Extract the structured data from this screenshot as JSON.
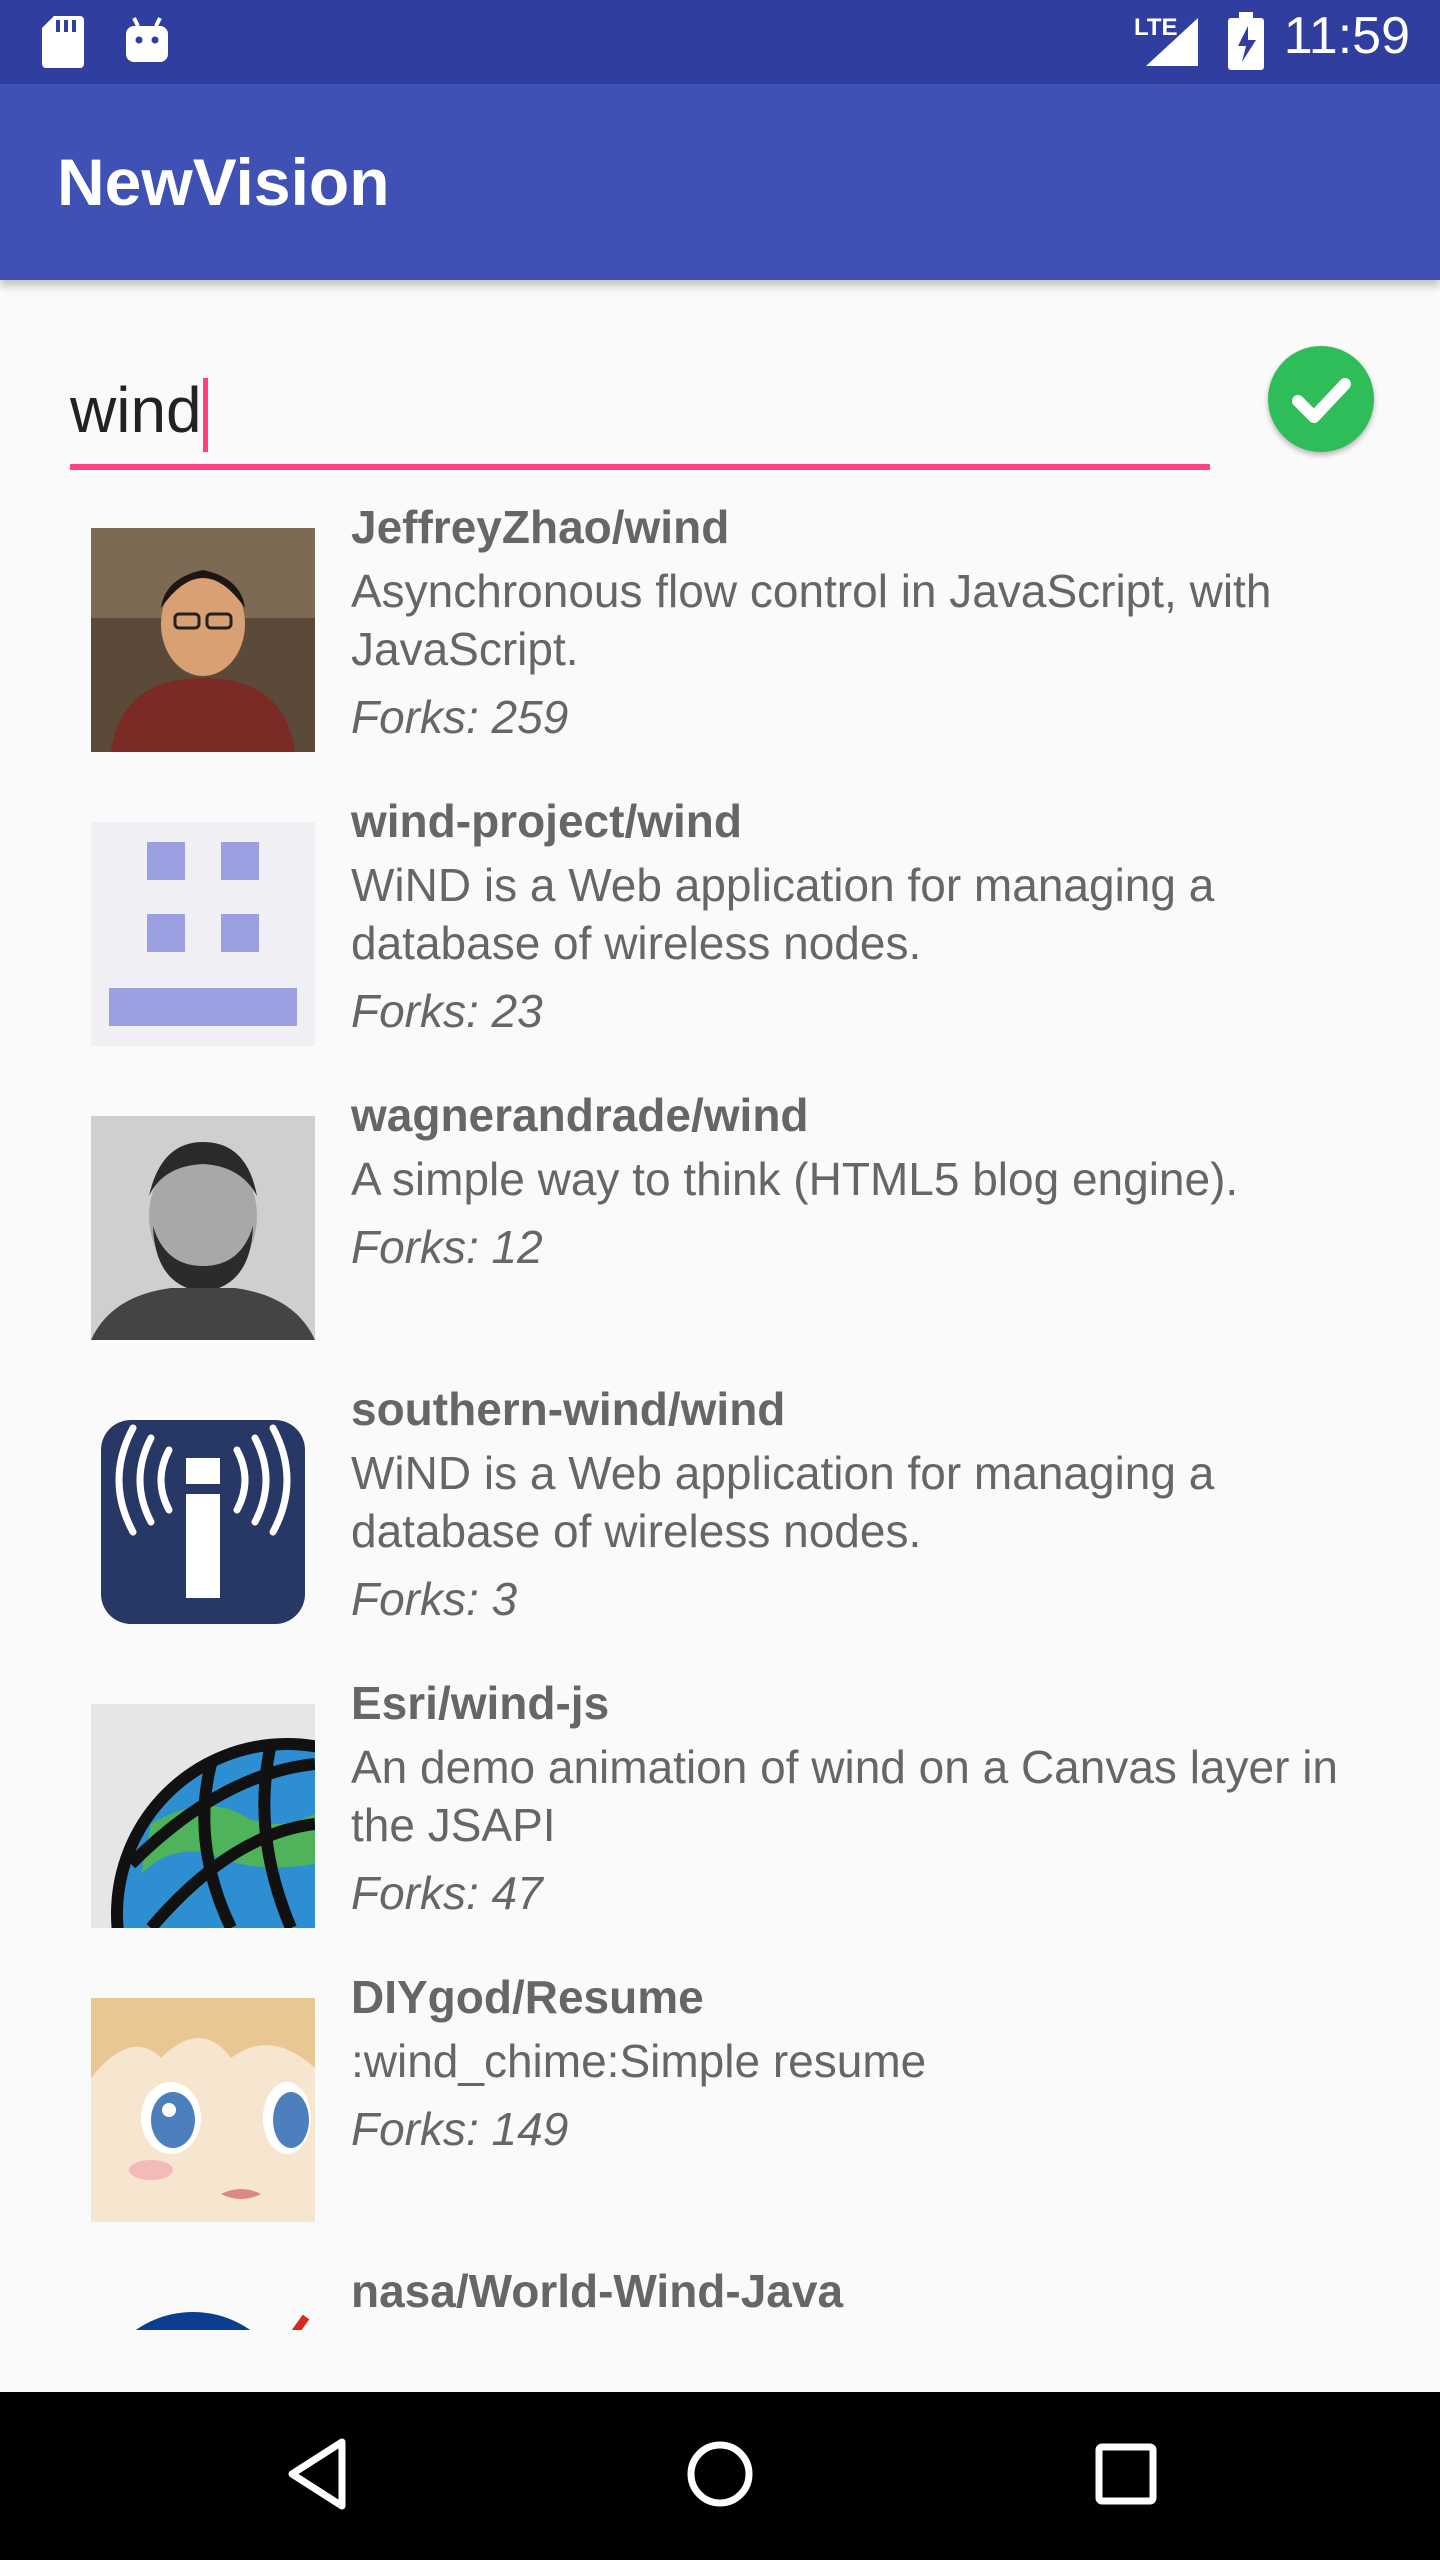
{
  "status_bar": {
    "time": "11:59",
    "network": "LTE",
    "left_icons": [
      "sd-card-icon",
      "android-icon"
    ],
    "right_icons": [
      "signal-icon",
      "battery-charging-icon"
    ]
  },
  "app_bar": {
    "title": "NewVision",
    "color": "#3f51b5"
  },
  "search": {
    "value": "wind",
    "underline_color": "#ff4081",
    "confirm_icon": "check-circle-icon",
    "confirm_color": "#2ebd59"
  },
  "repos": [
    {
      "name": "JeffreyZhao/wind",
      "description": "Asynchronous flow control in JavaScript, with JavaScript.",
      "forks": "Forks: 259",
      "avatar": "person-photo"
    },
    {
      "name": "wind-project/wind",
      "description": "WiND is a Web application for managing a database of wireless nodes.",
      "forks": "Forks: 23",
      "avatar": "identicon"
    },
    {
      "name": "wagnerandrade/wind",
      "description": "A simple way to think (HTML5 blog engine).",
      "forks": "Forks: 12",
      "avatar": "person-photo-bw"
    },
    {
      "name": "southern-wind/wind",
      "description": "WiND is a Web application for managing a database of wireless nodes.",
      "forks": "Forks: 3",
      "avatar": "wireless-info-logo"
    },
    {
      "name": "Esri/wind-js",
      "description": "An demo animation of wind on a Canvas layer in the JSAPI",
      "forks": "Forks: 47",
      "avatar": "globe-logo"
    },
    {
      "name": "DIYgod/Resume",
      "description": ":wind_chime:Simple resume",
      "forks": "Forks: 149",
      "avatar": "anime-avatar"
    },
    {
      "name": "nasa/World-Wind-Java",
      "description": "",
      "forks": "",
      "avatar": "nasa-logo"
    }
  ],
  "nav_bar": {
    "buttons": [
      "back-icon",
      "home-icon",
      "recents-icon"
    ]
  }
}
